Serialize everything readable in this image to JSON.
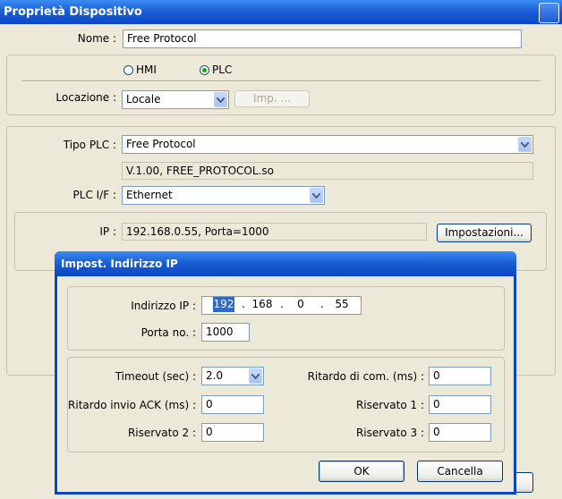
{
  "window": {
    "title": "Proprietà Dispositivo"
  },
  "name_field": {
    "label": "Nome :",
    "value": "Free Protocol"
  },
  "device_kind": {
    "hmi_label": "HMI",
    "plc_label": "PLC",
    "selected": "PLC"
  },
  "location": {
    "label": "Locazione :",
    "value": "Locale",
    "imp_button": "Imp. ..."
  },
  "plc": {
    "type_label": "Tipo PLC :",
    "type_value": "Free Protocol",
    "driver_info": "V.1.00, FREE_PROTOCOL.so",
    "if_label": "PLC I/F :",
    "if_value": "Ethernet",
    "ip_label": "IP :",
    "ip_value": "192.168.0.55,  Porta=1000",
    "settings_button": "Impostazioni..."
  },
  "dialog": {
    "title": "Impost. Indirizzo IP",
    "ip_label": "Indirizzo IP :",
    "ip": [
      "192",
      "168",
      "0",
      "55"
    ],
    "port_label": "Porta no. :",
    "port_value": "1000",
    "timeout_label": "Timeout (sec) :",
    "timeout_value": "2.0",
    "com_delay_label": "Ritardo di com. (ms) :",
    "com_delay_value": "0",
    "ack_delay_label": "Ritardo invio ACK (ms) :",
    "ack_delay_value": "0",
    "reserved1_label": "Riservato 1 :",
    "reserved1_value": "0",
    "reserved2_label": "Riservato 2 :",
    "reserved2_value": "0",
    "reserved3_label": "Riservato 3 :",
    "reserved3_value": "0",
    "ok_button": "OK",
    "cancel_button": "Cancella"
  }
}
